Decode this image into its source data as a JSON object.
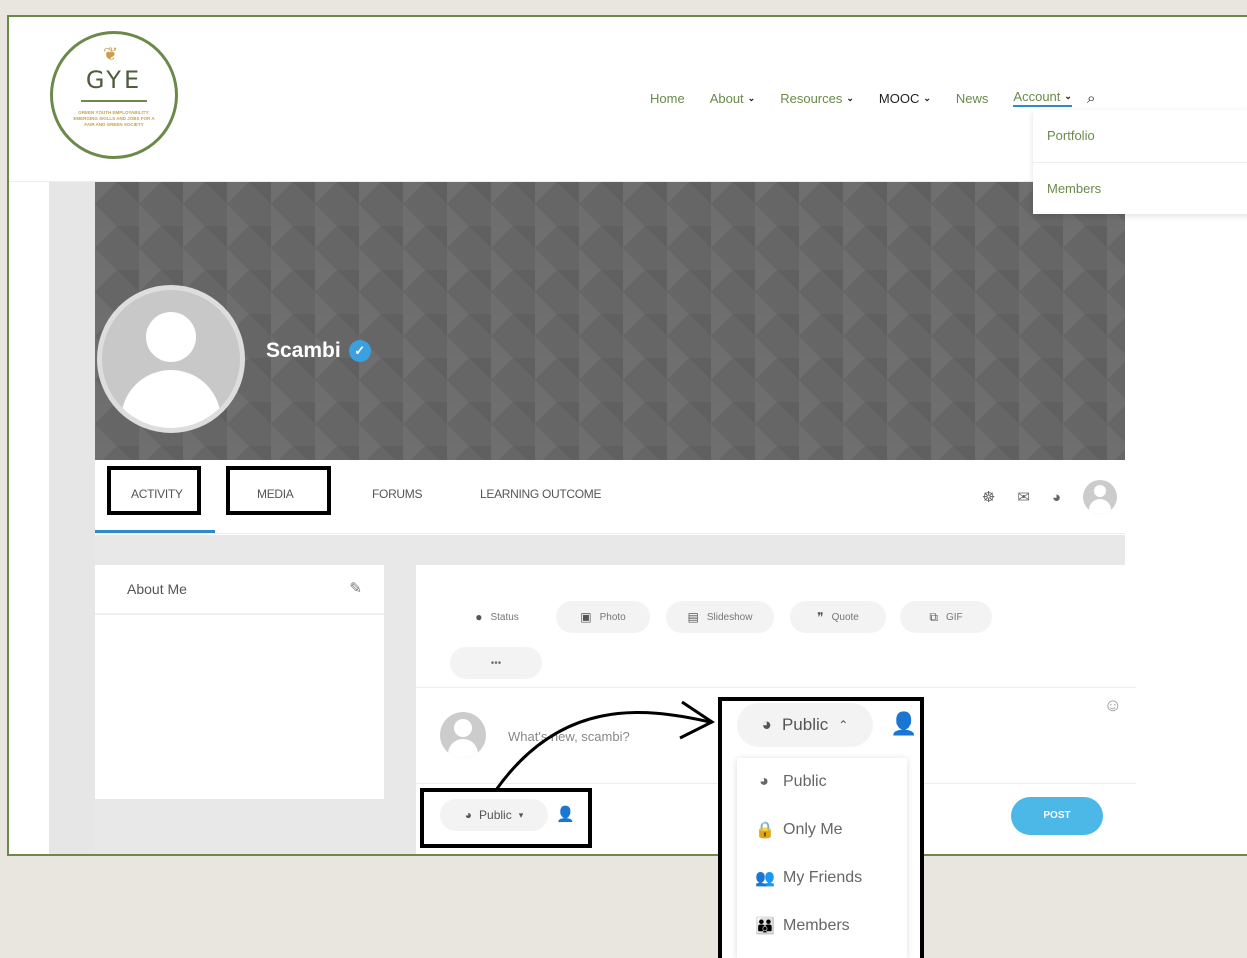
{
  "logo": {
    "sprout_icon": "sprout-icon",
    "wordmark": "GYE",
    "tagline": "GREEN YOUTH EMPLOYABILITY: EMERGING SKILLS AND JOBS FOR A FAIR AND GREEN SOCIETY"
  },
  "nav": {
    "home": "Home",
    "about": "About",
    "resources": "Resources",
    "mooc": "MOOC",
    "news": "News",
    "account": "Account"
  },
  "account_menu": {
    "portfolio": "Portfolio",
    "members": "Members"
  },
  "profile": {
    "name": "Scambi",
    "verified_icon": "verified-check-icon"
  },
  "tabs": {
    "activity": "ACTIVITY",
    "media": "MEDIA",
    "forums": "FORUMS",
    "learning_outcome": "LEARNING OUTCOME"
  },
  "about_widget": {
    "title": "About Me"
  },
  "post_types": {
    "status": "Status",
    "photo": "Photo",
    "slideshow": "Slideshow",
    "quote": "Quote",
    "gif": "GIF",
    "more": "•••"
  },
  "composer": {
    "placeholder": "What's new, scambi?",
    "privacy": "Public",
    "post": "POST"
  },
  "privacy_menu": {
    "selected": "Public",
    "options": [
      "Public",
      "Only Me",
      "My Friends",
      "Members"
    ]
  },
  "colors": {
    "brand_green": "#6b8a4a",
    "accent_blue": "#2e8bc9",
    "post_button": "#4bb8e8",
    "highlight_box": "#000000"
  }
}
